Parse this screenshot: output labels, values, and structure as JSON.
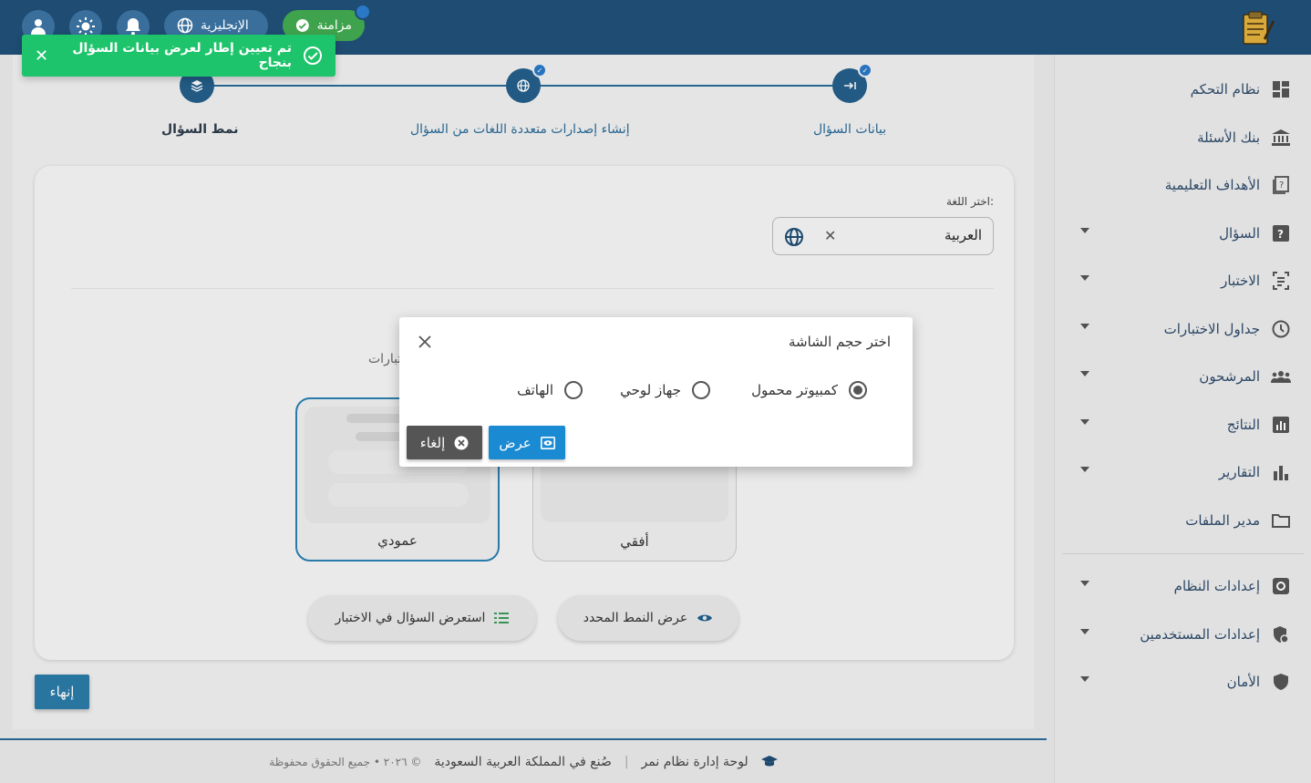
{
  "header": {
    "sync_label": "مزامنة",
    "language_label": "الإنجليزية"
  },
  "toast": {
    "message": "تم تعيين إطار لعرض بيانات السؤال بنجاح",
    "close": "✕"
  },
  "stepper": {
    "steps": [
      {
        "label": "بيانات السؤال",
        "icon": "arrow-right-to-line-icon",
        "state": "completed"
      },
      {
        "label": "إنشاء إصدارات متعددة اللغات من السؤال",
        "icon": "globe-icon",
        "state": "completed"
      },
      {
        "label": "نمط السؤال",
        "icon": "layers-icon",
        "state": "active"
      }
    ]
  },
  "language_picker": {
    "label": "اختر اللغة:",
    "value": "العربية",
    "clear": "✕"
  },
  "partial_text": "تبارات",
  "layouts": [
    {
      "label": "عمودي",
      "selected": true
    },
    {
      "label": "أفقي",
      "selected": false
    }
  ],
  "actions": {
    "preview_in_exam": "استعرض السؤال في الاختبار",
    "show_selected_style": "عرض النمط المحدد"
  },
  "finish_label": "إنهاء",
  "sidebar": {
    "items": [
      {
        "label": "نظام التحكم",
        "icon": "dashboard-icon",
        "has_caret": false
      },
      {
        "label": "بنك الأسئلة",
        "icon": "bank-icon",
        "has_caret": false
      },
      {
        "label": "الأهداف التعليمية",
        "icon": "book-question-icon",
        "has_caret": false
      },
      {
        "label": "السؤال",
        "icon": "question-square-icon",
        "has_caret": true
      },
      {
        "label": "الاختبار",
        "icon": "exam-frame-icon",
        "has_caret": true
      },
      {
        "label": "جداول الاختبارات",
        "icon": "clock-icon",
        "has_caret": true
      },
      {
        "label": "المرشحون",
        "icon": "people-icon",
        "has_caret": true
      },
      {
        "label": "النتائج",
        "icon": "bar-square-icon",
        "has_caret": true
      },
      {
        "label": "التقارير",
        "icon": "bar-chart-icon",
        "has_caret": true
      },
      {
        "label": "مدير الملفات",
        "icon": "folder-icon",
        "has_caret": false
      }
    ],
    "settings": [
      {
        "label": "إعدادات النظام",
        "icon": "gear-icon",
        "has_caret": true
      },
      {
        "label": "إعدادات المستخدمين",
        "icon": "user-shield-icon",
        "has_caret": true
      },
      {
        "label": "الأمان",
        "icon": "shield-icon",
        "has_caret": true
      }
    ]
  },
  "footer": {
    "brand": "لوحة إدارة نظام نمر",
    "made_in": "صُنع في المملكة العربية السعودية",
    "rights": "© ٢٠٢٦ • جميع الحقوق محفوظة"
  },
  "modal": {
    "title": "اختر حجم الشاشة",
    "options": [
      {
        "label": "كمبيوتر محمول",
        "selected": true
      },
      {
        "label": "جهاز لوحي",
        "selected": false
      },
      {
        "label": "الهاتف",
        "selected": false
      }
    ],
    "show_label": "عرض",
    "cancel_label": "إلغاء"
  },
  "colors": {
    "header": "#1e4c73",
    "accent": "#2a7aa6",
    "toast": "#1ec46b",
    "sync": "#3fa34d"
  }
}
